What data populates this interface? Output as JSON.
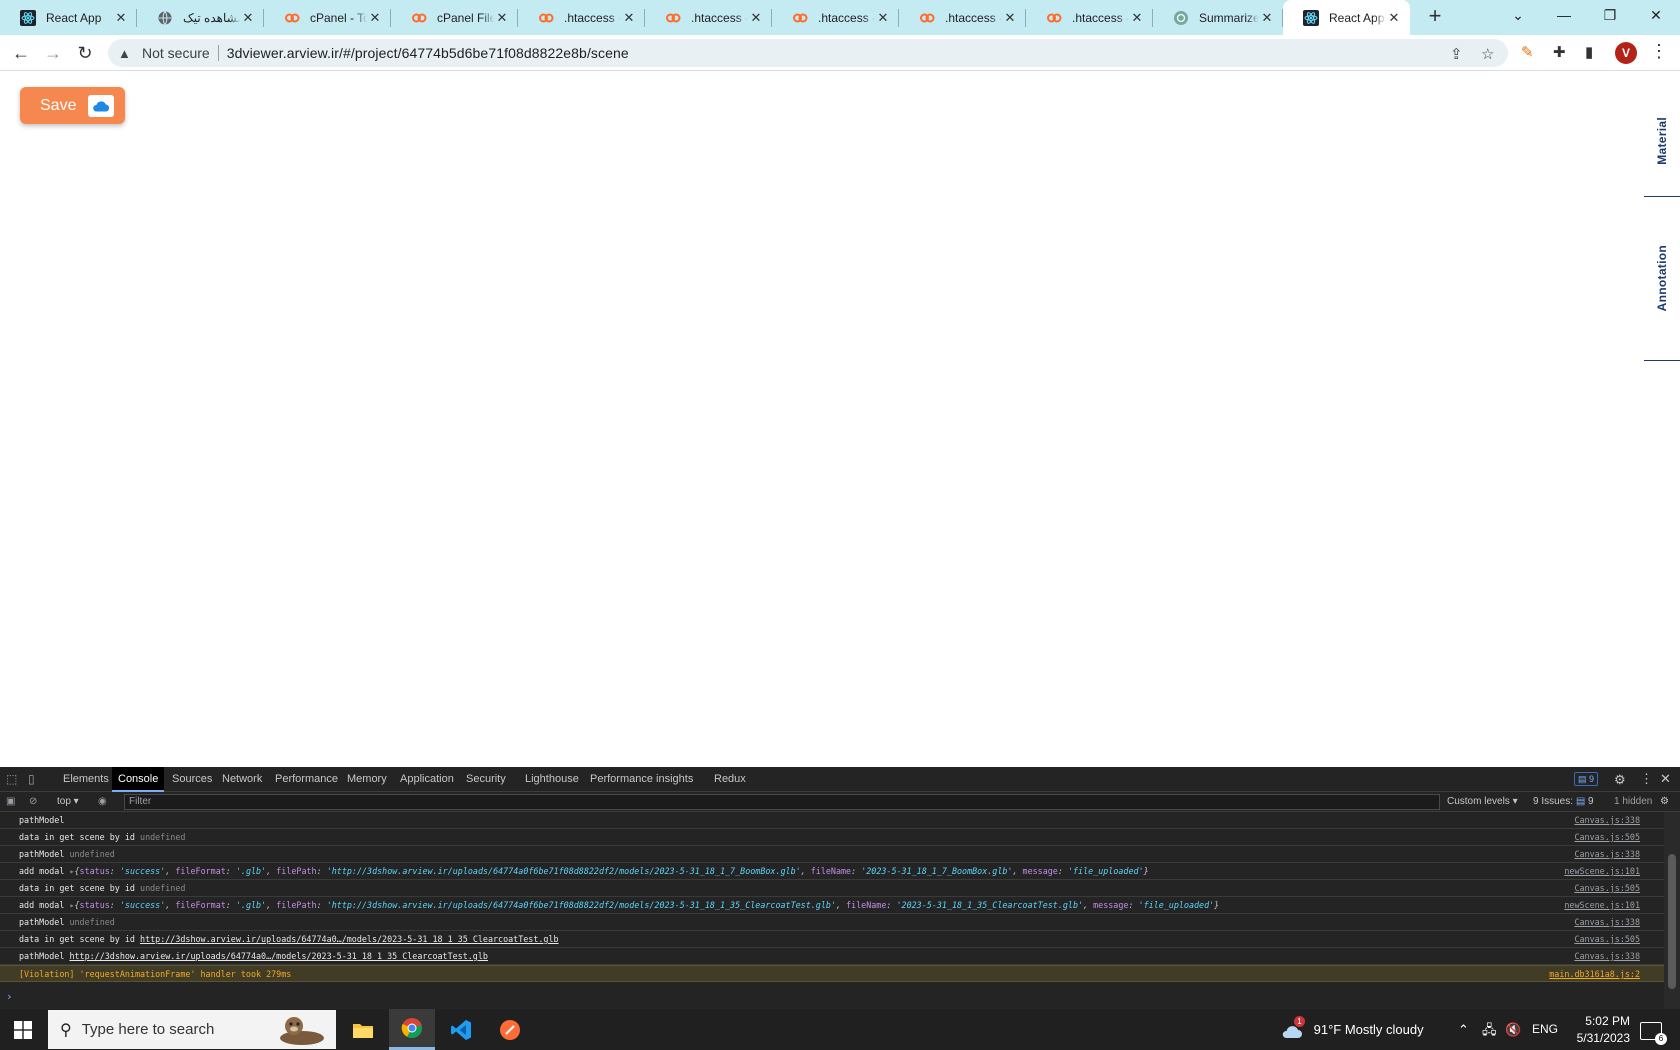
{
  "browser": {
    "tabs": [
      {
        "title": "React App",
        "icon": "react-icon"
      },
      {
        "title": "مشاهده تیک",
        "icon": "globe-icon"
      },
      {
        "title": "cPanel - Too",
        "icon": "cpanel-icon"
      },
      {
        "title": "cPanel File M",
        "icon": "cpanel-icon"
      },
      {
        "title": ".htaccess - c",
        "icon": "cpanel-icon"
      },
      {
        "title": ".htaccess - c",
        "icon": "cpanel-icon"
      },
      {
        "title": ".htaccess - c",
        "icon": "cpanel-icon"
      },
      {
        "title": ".htaccess - c",
        "icon": "cpanel-icon"
      },
      {
        "title": ".htaccess - c",
        "icon": "cpanel-icon"
      },
      {
        "title": "Summarize",
        "icon": "openai-icon"
      },
      {
        "title": "React App",
        "icon": "react-icon",
        "active": true
      }
    ],
    "address": {
      "security_label": "Not secure",
      "url": "3dviewer.arview.ir/#/project/64774b5d6be71f08d8822e8b/scene"
    },
    "profile_initial": "V"
  },
  "page": {
    "save_label": "Save",
    "side_tabs": [
      "Material",
      "Annotation"
    ]
  },
  "devtools": {
    "tabs": [
      "Elements",
      "Console",
      "Sources",
      "Network",
      "Performance",
      "Memory",
      "Application",
      "Security",
      "Lighthouse",
      "Performance insights",
      "Redux"
    ],
    "active_tab": "Console",
    "issues_badge": "9",
    "context": "top",
    "filter_placeholder": "Filter",
    "levels": "Custom levels",
    "issues_label": "9 Issues:",
    "issues_count": "9",
    "hidden": "1 hidden",
    "logs": [
      {
        "label": "pathModel",
        "value": "",
        "source": "Canvas.js:338"
      },
      {
        "label": "data in get scene by id",
        "value": "undefined",
        "source": "Canvas.js:505"
      },
      {
        "label": "pathModel",
        "value": "undefined",
        "source": "Canvas.js:338"
      },
      {
        "label": "add modal",
        "status": "'success'",
        "fileFormat": "'.glb'",
        "filePath": "'http://3dshow.arview.ir/uploads/64774a0f6be71f08d8822df2/models/2023-5-31_18_1_7_BoomBox.glb'",
        "fileName": "'2023-5-31_18_1_7_BoomBox.glb'",
        "message": "'file_uploaded'",
        "source": "newScene.js:101"
      },
      {
        "label": "data in get scene by id",
        "value": "undefined",
        "source": "Canvas.js:505"
      },
      {
        "label": "add modal",
        "status": "'success'",
        "fileFormat": "'.glb'",
        "filePath": "'http://3dshow.arview.ir/uploads/64774a0f6be71f08d8822df2/models/2023-5-31_18_1_35_ClearcoatTest.glb'",
        "fileName": "'2023-5-31_18_1_35_ClearcoatTest.glb'",
        "message": "'file_uploaded'",
        "source": "newScene.js:101"
      },
      {
        "label": "pathModel",
        "value": "undefined",
        "source": "Canvas.js:338"
      },
      {
        "label": "data in get scene by id",
        "link": "http://3dshow.arview.ir/uploads/64774a0…/models/2023-5-31 18 1 35 ClearcoatTest.glb",
        "source": "Canvas.js:505"
      },
      {
        "label": "pathModel",
        "link": "http://3dshow.arview.ir/uploads/64774a0…/models/2023-5-31 18 1 35 ClearcoatTest.glb",
        "source": "Canvas.js:338"
      },
      {
        "label": "[Violation] 'requestAnimationFrame' handler took 279ms",
        "source": "main.db3161a8.js:2",
        "violation": true
      }
    ],
    "prompt": "›"
  },
  "taskbar": {
    "search_placeholder": "Type here to search",
    "weather": "91°F  Mostly cloudy",
    "weather_badge": "1",
    "language": "ENG",
    "time": "5:02 PM",
    "date": "5/31/2023",
    "notifications": "6"
  },
  "colors": {
    "accent": "#f6884f",
    "tabstrip": "#c4eaf2",
    "side_tab_text": "#1c3a6e"
  }
}
